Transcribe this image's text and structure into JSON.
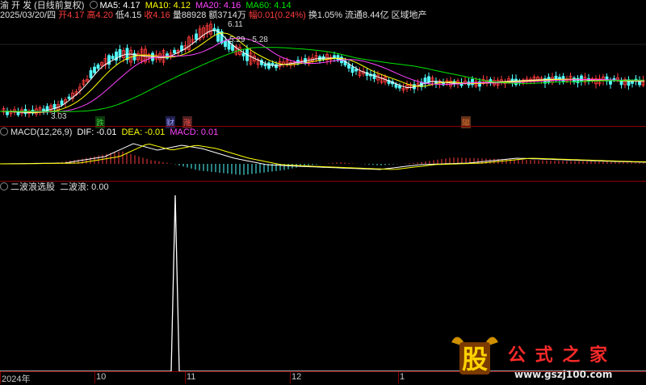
{
  "header": {
    "name": "渝 开 发",
    "adjust": "(日线前复权)",
    "ma5": "MA5: 4.17",
    "ma10": "MA10: 4.12",
    "ma20": "MA20: 4.16",
    "ma60": "MA60: 4.14"
  },
  "quote": {
    "date": "2025/03/20/四",
    "open": "开4.17",
    "high": "高4.20",
    "low": "低4.15",
    "close": "收4.16",
    "volume": "量88928",
    "amount": "额3714万",
    "change": "幅0.01(0.24%)",
    "turnover": "换1.05%",
    "float": "流通8.44亿",
    "sector": "区域地产"
  },
  "price_annotations": {
    "peak": "6.11",
    "range": "5.29 - 5.28",
    "low": "3.03"
  },
  "markers": [
    {
      "text": "跌",
      "color": "#3cc83c"
    },
    {
      "text": "财",
      "color": "#a0a0ff"
    },
    {
      "text": "涨",
      "color": "#ff5050"
    },
    {
      "text": "陽",
      "color": "#e07030"
    }
  ],
  "macd": {
    "title": "MACD(12,26,9)",
    "dif": "DIF: -0.01",
    "dea": "DEA: -0.01",
    "macd": "MACD: 0.01"
  },
  "indicator": {
    "title": "二波浪选股",
    "value": "二波浪: 0.00"
  },
  "x_axis": [
    "2024年",
    "10",
    "11",
    "12",
    "1"
  ],
  "watermark": {
    "glyph": "股",
    "brand": "公 式 之 家",
    "url": "www.gszj100.com"
  },
  "colors": {
    "up": "#ff3c3c",
    "down": "#54ffff",
    "ma5": "#ffffff",
    "ma10": "#ffff00",
    "ma20": "#ff44ff",
    "ma60": "#00e600",
    "panel_border": "#8a0000"
  }
}
